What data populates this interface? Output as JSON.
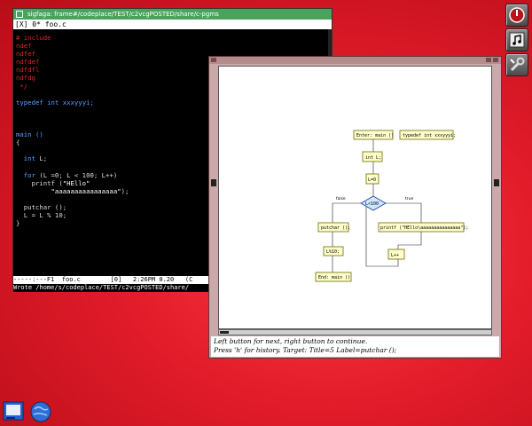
{
  "emacs": {
    "title": "sigfaga: frame#/codeplace/TEST/c2vcgPOSTED/share/c-pgms",
    "menubar": "[X] 0* foo.c",
    "code": {
      "pp1": "# include",
      "pp2": "ndef",
      "pp3": "ndfef",
      "pp4": "ndfdef",
      "pp5": "ndfdfl",
      "pp6": "ndfdg",
      "pp7": " */",
      "typedef_kw": "typedef",
      "typedef_rest": " int xxxyyyi;",
      "main_line": "main ()",
      "brace_open": "{",
      "decl_kw": "  int",
      "decl_rest": " L;",
      "for_kw": "  for",
      "for_rest": " (L =0; L < 100; L++)",
      "printf_line": "    printf (",
      "str1": "\"HEllo\"",
      "str2": "         \"aaaaaaaaaaaaaaaa\"",
      "printf_end": ");",
      "putchar_line": "  putchar ();",
      "assign_line": "  L = L % 10;",
      "brace_close": "}"
    },
    "modeline": "-----:---F1  foo.c        [0]   2:26PM 0.20   (C",
    "minibuffer": "Wrote /home/s/codeplace/TEST/c2vcgPOSTED/share/"
  },
  "vcg": {
    "nodes": {
      "enter": "Enter: main ()",
      "typedef": "typedef int xxxyyyi;",
      "decl": "int L;",
      "init": "L=0",
      "cond": "L<100",
      "putchar": "putchar ();",
      "printf": "printf (\"HEllo\\aaaaaaaaaaaaaaa\");",
      "mod": "L%10;",
      "inc": "L++",
      "exit": "End: main ()"
    },
    "edge_labels": {
      "false": "false",
      "true": "true"
    },
    "status": {
      "line1": "Left button for next, right button to continue.",
      "line2": "Press 'h' for history. Target: Title=5 Label=putchar ();"
    }
  },
  "colors": {
    "desktop": "#e31c2a",
    "emacs_title": "#4aa35a",
    "vcg_frame": "#c9a9a9",
    "node_fill": "#ffffcc",
    "diamond_fill": "#cfe6ff"
  },
  "icons": {
    "dock1": "shutdown-icon",
    "dock2": "music-note-icon",
    "dock3": "wrench-icon",
    "task1": "terminal-icon",
    "task2": "globe-icon"
  }
}
